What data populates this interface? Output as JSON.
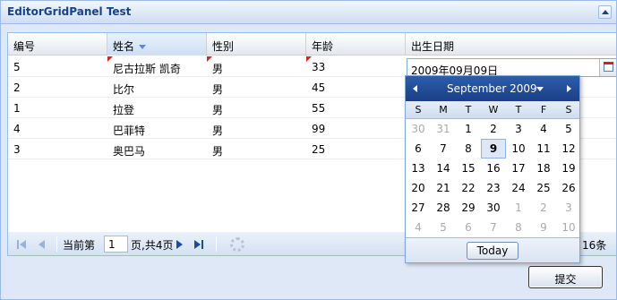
{
  "panel": {
    "title": "EditorGridPanel Test"
  },
  "grid": {
    "columns": [
      "编号",
      "姓名",
      "性别",
      "年龄",
      "出生日期"
    ],
    "rows": [
      [
        "5",
        "尼古拉斯 凯奇",
        "男",
        "33",
        ""
      ],
      [
        "2",
        "比尔",
        "男",
        "45",
        ""
      ],
      [
        "1",
        "拉登",
        "男",
        "55",
        ""
      ],
      [
        "4",
        "巴菲特",
        "男",
        "99",
        ""
      ],
      [
        "3",
        "奥巴马",
        "男",
        "25",
        ""
      ]
    ],
    "editor_value": "2009年09月09日"
  },
  "pager": {
    "page_prefix": "当前第",
    "page_value": "1",
    "page_suffix": "页,共4页",
    "total_fragment": "16条"
  },
  "datepicker": {
    "month_label": "September 2009",
    "weekdays": [
      "S",
      "M",
      "T",
      "W",
      "T",
      "F",
      "S"
    ],
    "weeks": [
      [
        "30",
        "31",
        "1",
        "2",
        "3",
        "4",
        "5"
      ],
      [
        "6",
        "7",
        "8",
        "9",
        "10",
        "11",
        "12"
      ],
      [
        "13",
        "14",
        "15",
        "16",
        "17",
        "18",
        "19"
      ],
      [
        "20",
        "21",
        "22",
        "23",
        "24",
        "25",
        "26"
      ],
      [
        "27",
        "28",
        "29",
        "30",
        "1",
        "2",
        "3"
      ],
      [
        "4",
        "5",
        "6",
        "7",
        "8",
        "9",
        "10"
      ]
    ],
    "selected_day": "9",
    "today_label": "Today"
  },
  "buttons": {
    "submit": "提交"
  },
  "colors": {
    "accent": "#1f4b9c",
    "border": "#99bbe8",
    "panel_bg": "#dfe8f6"
  }
}
